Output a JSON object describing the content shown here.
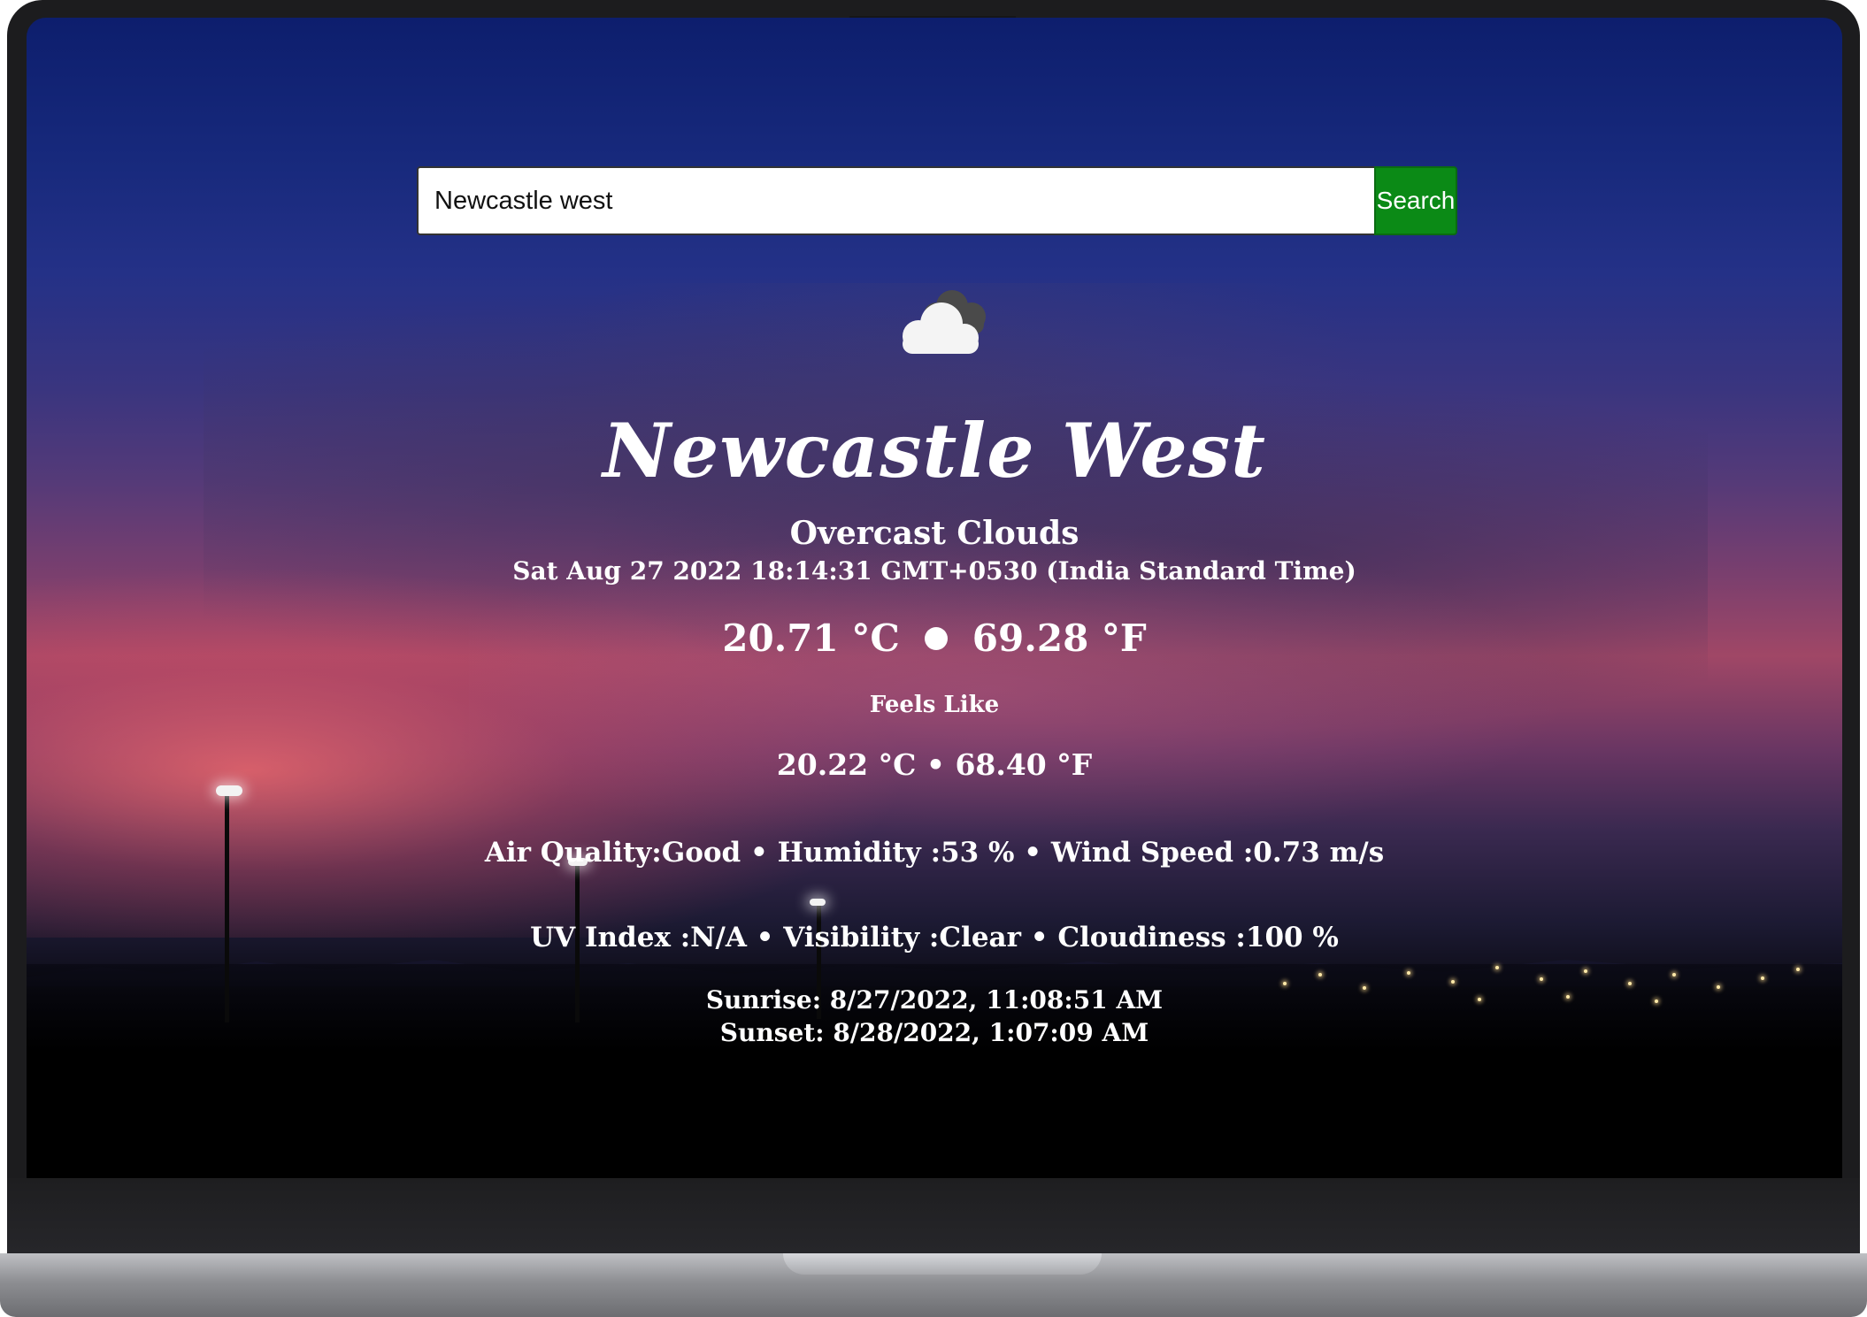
{
  "search": {
    "value": "Newcastle west",
    "button_label": "Search"
  },
  "weather": {
    "icon": "overcast-clouds-icon",
    "city": "Newcastle West",
    "condition": "Overcast Clouds",
    "datetime": "Sat Aug 27 2022 18:14:31 GMT+0530 (India Standard Time)",
    "temp_c": "20.71 °C",
    "temp_f": "69.28 °F",
    "feels_like_label": "Feels Like",
    "feels_like": "20.22 °C • 68.40 °F",
    "details_row1": "Air Quality:Good • Humidity :53 % • Wind Speed :0.73 m/s",
    "details_row2": "UV Index :N/A • Visibility :Clear • Cloudiness :100 %",
    "sunrise": "Sunrise: 8/27/2022, 11:08:51 AM",
    "sunset": "Sunset: 8/28/2022, 1:07:09 AM"
  },
  "colors": {
    "search_button": "#0b8a16",
    "text": "#ffffff"
  }
}
